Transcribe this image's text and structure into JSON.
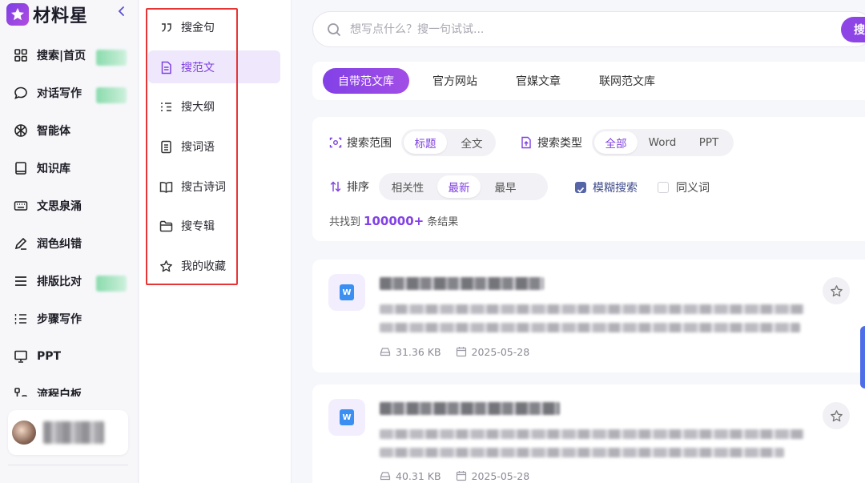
{
  "app": {
    "logo_text": "材料星"
  },
  "sidebar": {
    "items": [
      {
        "label": "搜索|首页",
        "icon": "grid-icon",
        "badge": true
      },
      {
        "label": "对话写作",
        "icon": "chat-bubble-icon",
        "badge": true
      },
      {
        "label": "智能体",
        "icon": "agent-icon",
        "badge": false
      },
      {
        "label": "知识库",
        "icon": "book-icon",
        "badge": false
      },
      {
        "label": "文思泉涌",
        "icon": "keyboard-icon",
        "badge": false
      },
      {
        "label": "润色纠错",
        "icon": "pen-icon",
        "badge": false
      },
      {
        "label": "排版比对",
        "icon": "lines-icon",
        "badge": true
      },
      {
        "label": "步骤写作",
        "icon": "ordered-list-icon",
        "badge": false
      },
      {
        "label": "PPT",
        "icon": "presentation-icon",
        "badge": false
      },
      {
        "label": "流程白板",
        "icon": "flow-icon",
        "badge": false
      }
    ]
  },
  "subnav": {
    "active_index": 1,
    "items": [
      {
        "label": "搜金句",
        "icon": "quote-icon"
      },
      {
        "label": "搜范文",
        "icon": "document-icon"
      },
      {
        "label": "搜大纲",
        "icon": "outline-icon"
      },
      {
        "label": "搜词语",
        "icon": "word-list-icon"
      },
      {
        "label": "搜古诗词",
        "icon": "open-book-icon"
      },
      {
        "label": "搜专辑",
        "icon": "folder-icon"
      },
      {
        "label": "我的收藏",
        "icon": "star-icon"
      }
    ]
  },
  "search": {
    "placeholder": "想写点什么？搜一句试试...",
    "value": "",
    "button_label": "搜"
  },
  "tabs": [
    {
      "label": "自带范文库",
      "active": true
    },
    {
      "label": "官方网站",
      "active": false
    },
    {
      "label": "官媒文章",
      "active": false
    },
    {
      "label": "联网范文库",
      "active": false
    }
  ],
  "filters": {
    "scope": {
      "label": "搜索范围",
      "options": [
        "标题",
        "全文"
      ],
      "active": 0
    },
    "type": {
      "label": "搜索类型",
      "options": [
        "全部",
        "Word",
        "PPT"
      ],
      "active": 0
    },
    "sort": {
      "label": "排序",
      "options": [
        "相关性",
        "最新",
        "最早"
      ],
      "active": 1
    },
    "fuzzy": {
      "label": "模糊搜索",
      "checked": true
    },
    "synonym": {
      "label": "同义词",
      "checked": false
    },
    "result": {
      "prefix": "共找到",
      "count": "100000+",
      "suffix": "条结果"
    }
  },
  "results": [
    {
      "file_type": "W",
      "size": "31.36 KB",
      "date": "2025-05-28"
    },
    {
      "file_type": "W",
      "size": "40.31 KB",
      "date": "2025-05-28"
    }
  ],
  "colors": {
    "accent": "#8241e6",
    "active_tint": "#efe8fc",
    "highlight_border": "#e53535",
    "word_blue": "#3b8ff0"
  }
}
